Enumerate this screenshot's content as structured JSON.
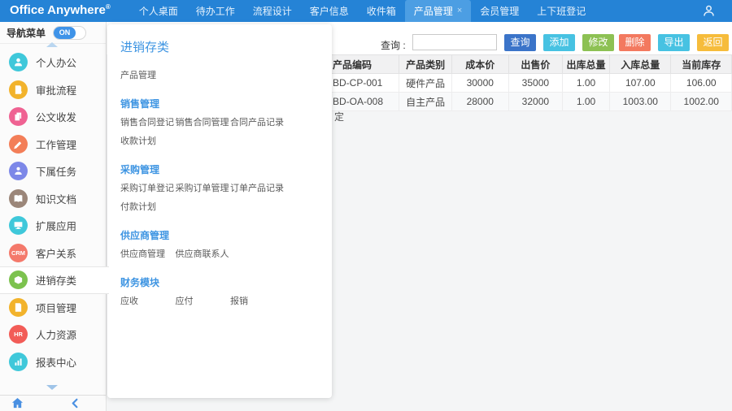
{
  "topbar": {
    "logo": "Office Anywhere",
    "logo_reg": "®",
    "tabs": [
      {
        "label": "个人桌面",
        "active": false
      },
      {
        "label": "待办工作",
        "active": false
      },
      {
        "label": "流程设计",
        "active": false
      },
      {
        "label": "客户信息",
        "active": false
      },
      {
        "label": "收件箱",
        "active": false
      },
      {
        "label": "产品管理",
        "active": true,
        "closable": true
      },
      {
        "label": "会员管理",
        "active": false
      },
      {
        "label": "上下班登记",
        "active": false
      }
    ],
    "colors": {
      "bar": "#2583d6",
      "active_tab": "#4c9ee3"
    }
  },
  "sidebar": {
    "nav_label": "导航菜单",
    "toggle_state": "ON",
    "items": [
      {
        "label": "个人办公",
        "icon": "user-icon",
        "color": "#3fc8da"
      },
      {
        "label": "审批流程",
        "icon": "approval-doc-icon",
        "color": "#f2b32c"
      },
      {
        "label": "公文收发",
        "icon": "documents-icon",
        "color": "#ef6292"
      },
      {
        "label": "工作管理",
        "icon": "work-pen-icon",
        "color": "#f37e58"
      },
      {
        "label": "下属任务",
        "icon": "subordinate-user-icon",
        "color": "#7d88e8"
      },
      {
        "label": "知识文档",
        "icon": "book-icon",
        "color": "#9b8679"
      },
      {
        "label": "扩展应用",
        "icon": "monitor-icon",
        "color": "#3fc8da"
      },
      {
        "label": "客户关系",
        "icon": "crm-badge-icon",
        "color": "#f4796b",
        "badge": "CRM"
      },
      {
        "label": "进销存类",
        "icon": "inventory-box-icon",
        "color": "#7cc24e",
        "selected": true
      },
      {
        "label": "项目管理",
        "icon": "project-doc-icon",
        "color": "#f2b32c"
      },
      {
        "label": "人力资源",
        "icon": "hr-badge-icon",
        "color": "#f25c57",
        "badge": "HR"
      },
      {
        "label": "报表中心",
        "icon": "bar-chart-icon",
        "color": "#3fc8da"
      }
    ]
  },
  "flyout": {
    "title": "进销存类",
    "top_item": "产品管理",
    "sections": [
      {
        "label": "销售管理",
        "items": [
          "销售合同登记",
          "销售合同管理",
          "合同产品记录",
          "收款计划"
        ]
      },
      {
        "label": "采购管理",
        "items": [
          "采购订单登记",
          "采购订单管理",
          "订单产品记录",
          "付款计划"
        ]
      },
      {
        "label": "供应商管理",
        "items": [
          "供应商管理",
          "供应商联系人"
        ]
      },
      {
        "label": "财务模块",
        "items": [
          "应收",
          "应付",
          "报销"
        ]
      }
    ]
  },
  "toolbar": {
    "search_label": "查询 :",
    "search_value": "",
    "buttons": [
      {
        "label": "查询",
        "color": "#3b74c9"
      },
      {
        "label": "添加",
        "color": "#47c2e2"
      },
      {
        "label": "修改",
        "color": "#8dc153"
      },
      {
        "label": "删除",
        "color": "#f3795f"
      },
      {
        "label": "导出",
        "color": "#47c2e2"
      },
      {
        "label": "返回",
        "color": "#f6bc3b"
      }
    ]
  },
  "table": {
    "columns": [
      "产品编码",
      "产品类别",
      "成本价",
      "出售价",
      "出库总量",
      "入库总量",
      "当前库存"
    ],
    "rows": [
      [
        "BD-CP-001",
        "硬件产品",
        "30000",
        "35000",
        "1.00",
        "107.00",
        "106.00"
      ],
      [
        "BD-OA-008",
        "自主产品",
        "28000",
        "32000",
        "1.00",
        "1003.00",
        "1002.00"
      ]
    ]
  },
  "fragment_text": "定"
}
